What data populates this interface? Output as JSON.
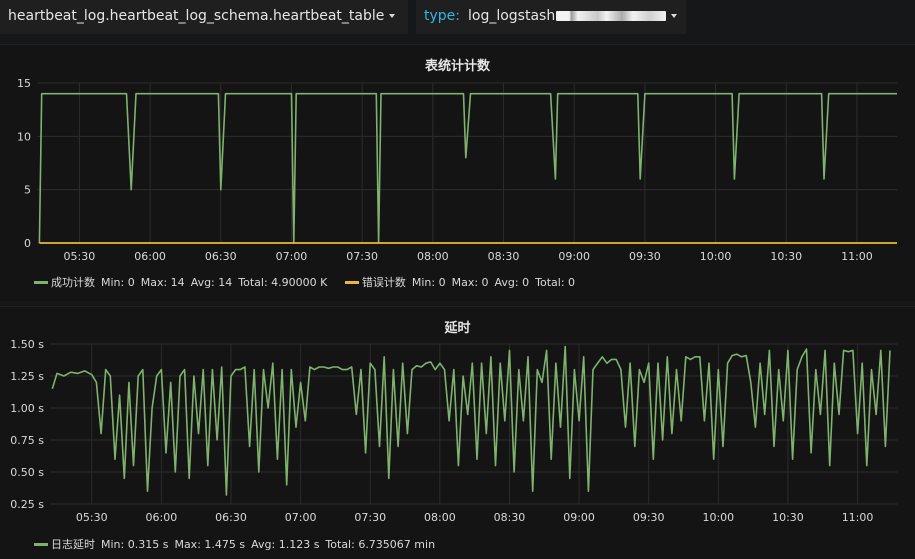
{
  "topbar": {
    "datasource": "heartbeat_log.heartbeat_log_schema.heartbeat_table",
    "variable_key": "type:",
    "variable_value": "log_logstash",
    "caret_icon": "caret-down-icon"
  },
  "panels": [
    {
      "title": "表统计计数",
      "legend": [
        {
          "name": "成功计数",
          "color": "#7eb26d",
          "min": "Min: 0",
          "max": "Max: 14",
          "avg": "Avg: 14",
          "total": "Total: 4.90000 K"
        },
        {
          "name": "错误计数",
          "color": "#eab839",
          "min": "Min: 0",
          "max": "Max: 0",
          "avg": "Avg: 0",
          "total": "Total: 0"
        }
      ]
    },
    {
      "title": "延时",
      "legend": [
        {
          "name": "日志延时",
          "color": "#7eb26d",
          "min": "Min: 0.315 s",
          "max": "Max: 1.475 s",
          "avg": "Avg: 1.123 s",
          "total": "Total: 6.735067 min"
        }
      ]
    }
  ],
  "chart_data": [
    {
      "type": "line",
      "title": "表统计计数",
      "x_tick_labels": [
        "05:30",
        "06:00",
        "06:30",
        "07:00",
        "07:30",
        "08:00",
        "08:30",
        "09:00",
        "09:30",
        "10:00",
        "10:30",
        "11:00"
      ],
      "x_tick_minutes": [
        330,
        360,
        390,
        420,
        450,
        480,
        510,
        540,
        570,
        600,
        630,
        660
      ],
      "xlim_minutes": [
        312,
        677
      ],
      "ylim": [
        0,
        15
      ],
      "y_ticks": [
        0,
        5,
        10,
        15
      ],
      "y_tick_labels": [
        "0",
        "5",
        "10",
        "15"
      ],
      "grid": true,
      "legend_position": "bottom-left",
      "series": [
        {
          "name": "成功计数",
          "color": "#7eb26d",
          "x_minutes": [
            313,
            314,
            316,
            350,
            352,
            354,
            389,
            390,
            392,
            420,
            421,
            422,
            456,
            457,
            458,
            493,
            494,
            496,
            530,
            532,
            533,
            567,
            568,
            570,
            607,
            608,
            610,
            645,
            646,
            648,
            682
          ],
          "values": [
            0,
            14,
            14,
            14,
            5,
            14,
            14,
            5,
            14,
            14,
            0,
            14,
            14,
            0,
            14,
            14,
            8,
            14,
            14,
            6,
            14,
            14,
            6,
            14,
            14,
            6,
            14,
            14,
            6,
            14,
            14
          ]
        },
        {
          "name": "错误计数",
          "color": "#eab839",
          "x_minutes": [
            313,
            677
          ],
          "values": [
            0,
            0
          ]
        }
      ]
    },
    {
      "type": "line",
      "title": "延时",
      "x_tick_labels": [
        "05:30",
        "06:00",
        "06:30",
        "07:00",
        "07:30",
        "08:00",
        "08:30",
        "09:00",
        "09:30",
        "10:00",
        "10:30",
        "11:00"
      ],
      "x_tick_minutes": [
        330,
        360,
        390,
        420,
        450,
        480,
        510,
        540,
        570,
        600,
        630,
        660
      ],
      "xlim_minutes": [
        312,
        677
      ],
      "ylim": [
        0.25,
        1.5
      ],
      "y_ticks": [
        0.25,
        0.5,
        0.75,
        1.0,
        1.25,
        1.5
      ],
      "y_tick_labels": [
        "0.25 s",
        "0.50 s",
        "0.75 s",
        "1.00 s",
        "1.25 s",
        "1.50 s"
      ],
      "grid": true,
      "legend_position": "bottom-left",
      "series": [
        {
          "name": "日志延时",
          "color": "#7eb26d",
          "x_minutes": [
            313,
            315,
            318,
            321,
            324,
            327,
            330,
            332,
            334,
            336,
            338,
            340,
            342,
            344,
            346,
            348,
            350,
            352,
            354,
            356,
            358,
            360,
            362,
            364,
            366,
            368,
            370,
            372,
            374,
            376,
            378,
            380,
            382,
            384,
            386,
            388,
            390,
            392,
            394,
            396,
            398,
            400,
            402,
            404,
            406,
            408,
            410,
            412,
            414,
            416,
            418,
            420,
            422,
            424,
            426,
            428,
            430,
            432,
            434,
            436,
            438,
            440,
            442,
            444,
            446,
            448,
            450,
            452,
            454,
            456,
            458,
            460,
            462,
            464,
            466,
            468,
            470,
            472,
            474,
            476,
            478,
            480,
            482,
            484,
            486,
            488,
            490,
            492,
            494,
            496,
            498,
            500,
            502,
            504,
            506,
            508,
            510,
            512,
            514,
            516,
            518,
            520,
            522,
            524,
            526,
            528,
            530,
            532,
            534,
            536,
            538,
            540,
            542,
            544,
            546,
            548,
            550,
            552,
            554,
            556,
            558,
            560,
            562,
            564,
            566,
            568,
            570,
            572,
            574,
            576,
            578,
            580,
            582,
            584,
            586,
            588,
            590,
            592,
            594,
            596,
            598,
            600,
            602,
            604,
            606,
            608,
            610,
            612,
            614,
            616,
            618,
            620,
            622,
            624,
            626,
            628,
            630,
            632,
            634,
            636,
            638,
            640,
            642,
            644,
            646,
            648,
            650,
            652,
            654,
            656,
            658,
            660,
            662,
            664,
            666,
            668,
            670,
            672,
            674,
            676
          ],
          "values": [
            1.15,
            1.27,
            1.25,
            1.28,
            1.27,
            1.29,
            1.26,
            1.2,
            0.8,
            1.3,
            1.25,
            0.6,
            1.1,
            0.45,
            1.2,
            0.55,
            1.25,
            1.3,
            0.35,
            1.0,
            1.25,
            1.3,
            0.65,
            1.2,
            0.5,
            1.25,
            1.3,
            0.45,
            1.25,
            0.8,
            1.3,
            0.55,
            1.3,
            0.75,
            1.32,
            0.32,
            1.25,
            1.3,
            1.3,
            1.32,
            0.7,
            1.3,
            0.5,
            1.3,
            1.0,
            1.35,
            0.6,
            1.3,
            0.4,
            1.3,
            0.85,
            1.2,
            0.9,
            1.32,
            1.3,
            1.32,
            1.32,
            1.31,
            1.32,
            1.32,
            1.3,
            1.3,
            1.32,
            0.95,
            1.3,
            0.65,
            1.35,
            1.3,
            0.7,
            1.4,
            0.45,
            1.3,
            0.7,
            1.35,
            0.8,
            1.3,
            1.33,
            1.32,
            1.35,
            1.36,
            1.3,
            1.35,
            1.3,
            0.9,
            1.3,
            0.55,
            1.25,
            0.95,
            1.35,
            0.6,
            1.35,
            0.8,
            1.4,
            0.55,
            1.35,
            0.9,
            1.45,
            0.5,
            1.3,
            0.9,
            1.4,
            0.35,
            1.3,
            1.2,
            1.45,
            0.6,
            1.35,
            0.85,
            1.48,
            0.45,
            1.3,
            0.9,
            1.4,
            0.35,
            1.3,
            1.35,
            1.4,
            1.35,
            1.38,
            1.38,
            1.3,
            0.85,
            1.35,
            0.7,
            1.3,
            1.2,
            1.35,
            0.6,
            1.35,
            0.75,
            1.4,
            0.8,
            1.3,
            0.9,
            1.4,
            1.38,
            1.4,
            1.4,
            0.9,
            1.35,
            0.6,
            1.3,
            0.7,
            1.35,
            1.41,
            1.42,
            1.4,
            1.41,
            1.2,
            0.85,
            1.35,
            0.95,
            1.45,
            0.7,
            1.3,
            0.9,
            1.45,
            0.6,
            1.3,
            1.4,
            1.46,
            0.65,
            1.3,
            0.95,
            1.45,
            0.55,
            1.35,
            0.95,
            1.45,
            1.44,
            1.45,
            0.8,
            1.35,
            0.55,
            1.3,
            0.95,
            1.45,
            0.7,
            1.45
          ]
        }
      ]
    }
  ]
}
